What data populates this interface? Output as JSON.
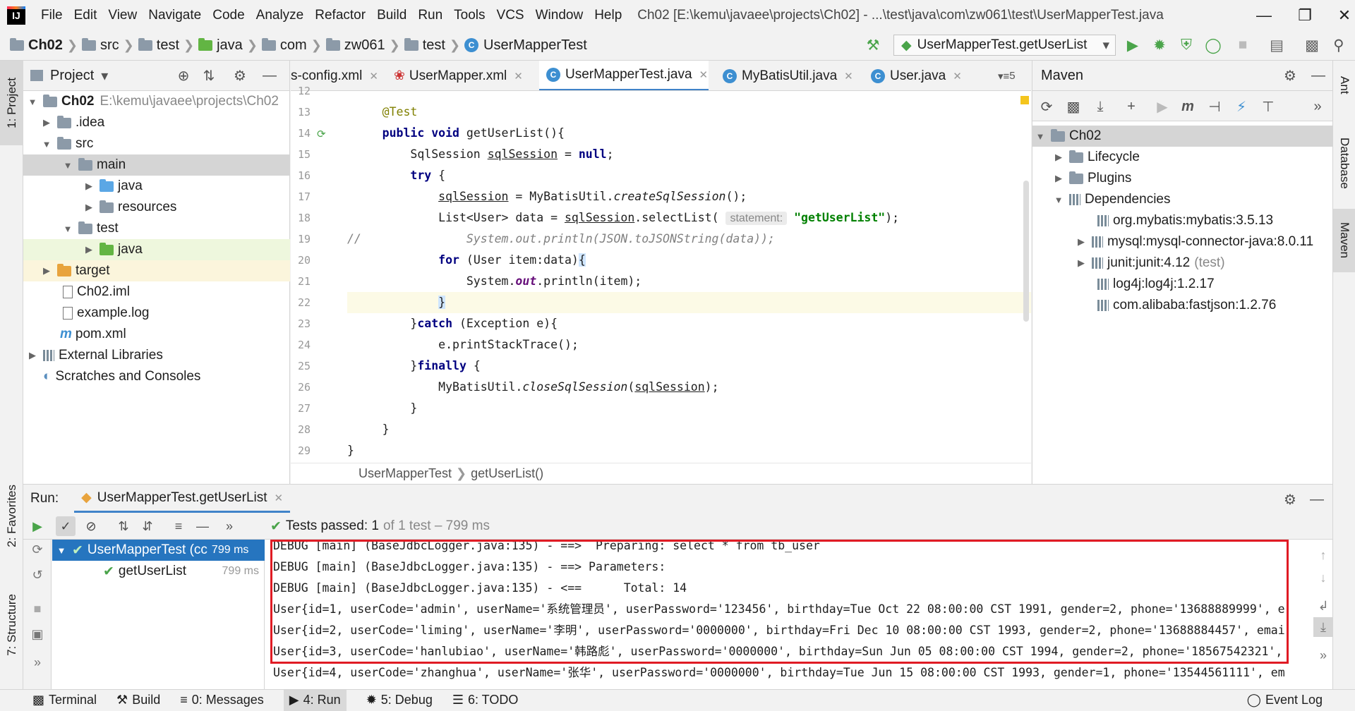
{
  "menu": [
    "File",
    "Edit",
    "View",
    "Navigate",
    "Code",
    "Analyze",
    "Refactor",
    "Build",
    "Run",
    "Tools",
    "VCS",
    "Window",
    "Help"
  ],
  "window_title": "Ch02 [E:\\kemu\\javaee\\projects\\Ch02] - ...\\test\\java\\com\\zw061\\test\\UserMapperTest.java",
  "breadcrumbs": [
    "Ch02",
    "src",
    "test",
    "java",
    "com",
    "zw061",
    "test",
    "UserMapperTest"
  ],
  "run_config": "UserMapperTest.getUserList",
  "left_tabs": [
    "1: Project",
    "2: Favorites",
    "7: Structure"
  ],
  "right_tabs": [
    "Ant",
    "Database",
    "Maven"
  ],
  "project": {
    "header": "Project",
    "tree": [
      {
        "label": "Ch02",
        "detail": "E:\\kemu\\javaee\\projects\\Ch02"
      },
      {
        "label": ".idea"
      },
      {
        "label": "src"
      },
      {
        "label": "main"
      },
      {
        "label": "java"
      },
      {
        "label": "resources"
      },
      {
        "label": "test"
      },
      {
        "label": "java"
      },
      {
        "label": "target"
      },
      {
        "label": "Ch02.iml"
      },
      {
        "label": "example.log"
      },
      {
        "label": "pom.xml"
      },
      {
        "label": "External Libraries"
      },
      {
        "label": "Scratches and Consoles"
      }
    ]
  },
  "editor": {
    "tabs": [
      "s-config.xml",
      "UserMapper.xml",
      "UserMapperTest.java",
      "MyBatisUtil.java",
      "User.java"
    ],
    "tab_overflow": "5",
    "line_numbers": [
      "12",
      "13",
      "14",
      "15",
      "16",
      "17",
      "18",
      "19",
      "20",
      "21",
      "22",
      "23",
      "24",
      "25",
      "26",
      "27",
      "28",
      "29"
    ],
    "hint_statement": "statement:",
    "breadcrumb": [
      "UserMapperTest",
      "getUserList()"
    ]
  },
  "maven": {
    "header": "Maven",
    "root": "Ch02",
    "items": [
      "Lifecycle",
      "Plugins",
      "Dependencies"
    ],
    "deps": [
      "org.mybatis:mybatis:3.5.13",
      "mysql:mysql-connector-java:8.0.11",
      "junit:junit:4.12",
      "log4j:log4j:1.2.17",
      "com.alibaba:fastjson:1.2.76"
    ],
    "junit_scope": "(test)"
  },
  "run": {
    "label": "Run:",
    "tab": "UserMapperTest.getUserList",
    "status_bold": "Tests passed: 1",
    "status_rest": "of 1 test – 799 ms",
    "tree": [
      {
        "label": "UserMapperTest (cc",
        "time": "799 ms"
      },
      {
        "label": "getUserList",
        "time": "799 ms"
      }
    ],
    "console": [
      "DEBUG [main] (BaseJdbcLogger.java:135) - ==>  Preparing: select * from tb_user",
      "DEBUG [main] (BaseJdbcLogger.java:135) - ==> Parameters: ",
      "DEBUG [main] (BaseJdbcLogger.java:135) - <==      Total: 14",
      "User{id=1, userCode='admin', userName='系统管理员', userPassword='123456', birthday=Tue Oct 22 08:00:00 CST 1991, gender=2, phone='13688889999', e",
      "User{id=2, userCode='liming', userName='李明', userPassword='0000000', birthday=Fri Dec 10 08:00:00 CST 1993, gender=2, phone='13688884457', emai",
      "User{id=3, userCode='hanlubiao', userName='韩路彪', userPassword='0000000', birthday=Sun Jun 05 08:00:00 CST 1994, gender=2, phone='18567542321', ",
      "User{id=4, userCode='zhanghua', userName='张华', userPassword='0000000', birthday=Tue Jun 15 08:00:00 CST 1993, gender=1, phone='13544561111', em"
    ]
  },
  "statusbar": {
    "items": [
      "Terminal",
      "Build",
      "0: Messages",
      "4: Run",
      "5: Debug",
      "6: TODO"
    ],
    "event_log": "Event Log"
  },
  "colors": {
    "accent": "#4083c9",
    "run_green": "#4aa44a",
    "highlight_box": "#e01b24",
    "selected_row": "#2675bf"
  }
}
